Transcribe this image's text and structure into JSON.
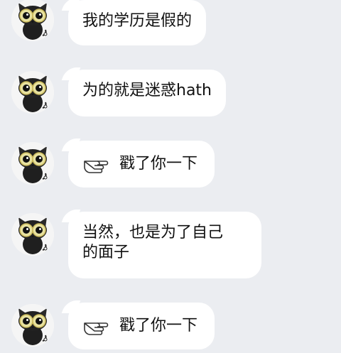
{
  "colors": {
    "background": "#ebedf1",
    "bubble": "#ffffff",
    "text": "#111111"
  },
  "messages": [
    {
      "type": "text",
      "lines": [
        "我的学历是假的"
      ]
    },
    {
      "type": "text",
      "lines": [
        "为的就是迷惑hath"
      ]
    },
    {
      "type": "poke",
      "text": "戳了你一下",
      "icon": "poke-hand-icon"
    },
    {
      "type": "text",
      "lines": [
        "当然，也是为了自己",
        "的面子"
      ]
    },
    {
      "type": "poke",
      "text": "戳了你一下",
      "icon": "poke-hand-icon"
    }
  ]
}
